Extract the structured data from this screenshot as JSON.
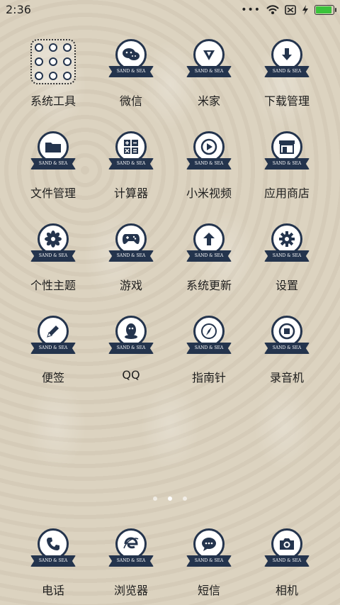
{
  "status": {
    "time": "2:36"
  },
  "apps": [
    {
      "label": "系统工具",
      "icon": "folder-grid-icon"
    },
    {
      "label": "微信",
      "icon": "wechat-icon"
    },
    {
      "label": "米家",
      "icon": "mijia-icon"
    },
    {
      "label": "下载管理",
      "icon": "download-icon"
    },
    {
      "label": "文件管理",
      "icon": "folder-icon"
    },
    {
      "label": "计算器",
      "icon": "calculator-icon"
    },
    {
      "label": "小米视频",
      "icon": "play-icon"
    },
    {
      "label": "应用商店",
      "icon": "store-icon"
    },
    {
      "label": "个性主题",
      "icon": "flower-icon"
    },
    {
      "label": "游戏",
      "icon": "gamepad-icon"
    },
    {
      "label": "系统更新",
      "icon": "upload-icon"
    },
    {
      "label": "设置",
      "icon": "gear-icon"
    },
    {
      "label": "便签",
      "icon": "pencil-icon"
    },
    {
      "label": "QQ",
      "icon": "qq-icon"
    },
    {
      "label": "指南针",
      "icon": "compass-icon"
    },
    {
      "label": "录音机",
      "icon": "record-icon"
    }
  ],
  "dock": [
    {
      "label": "电话",
      "icon": "phone-icon"
    },
    {
      "label": "浏览器",
      "icon": "browser-icon"
    },
    {
      "label": "短信",
      "icon": "message-icon"
    },
    {
      "label": "相机",
      "icon": "camera-icon"
    }
  ],
  "ribbon_text": "SAND & SEA"
}
